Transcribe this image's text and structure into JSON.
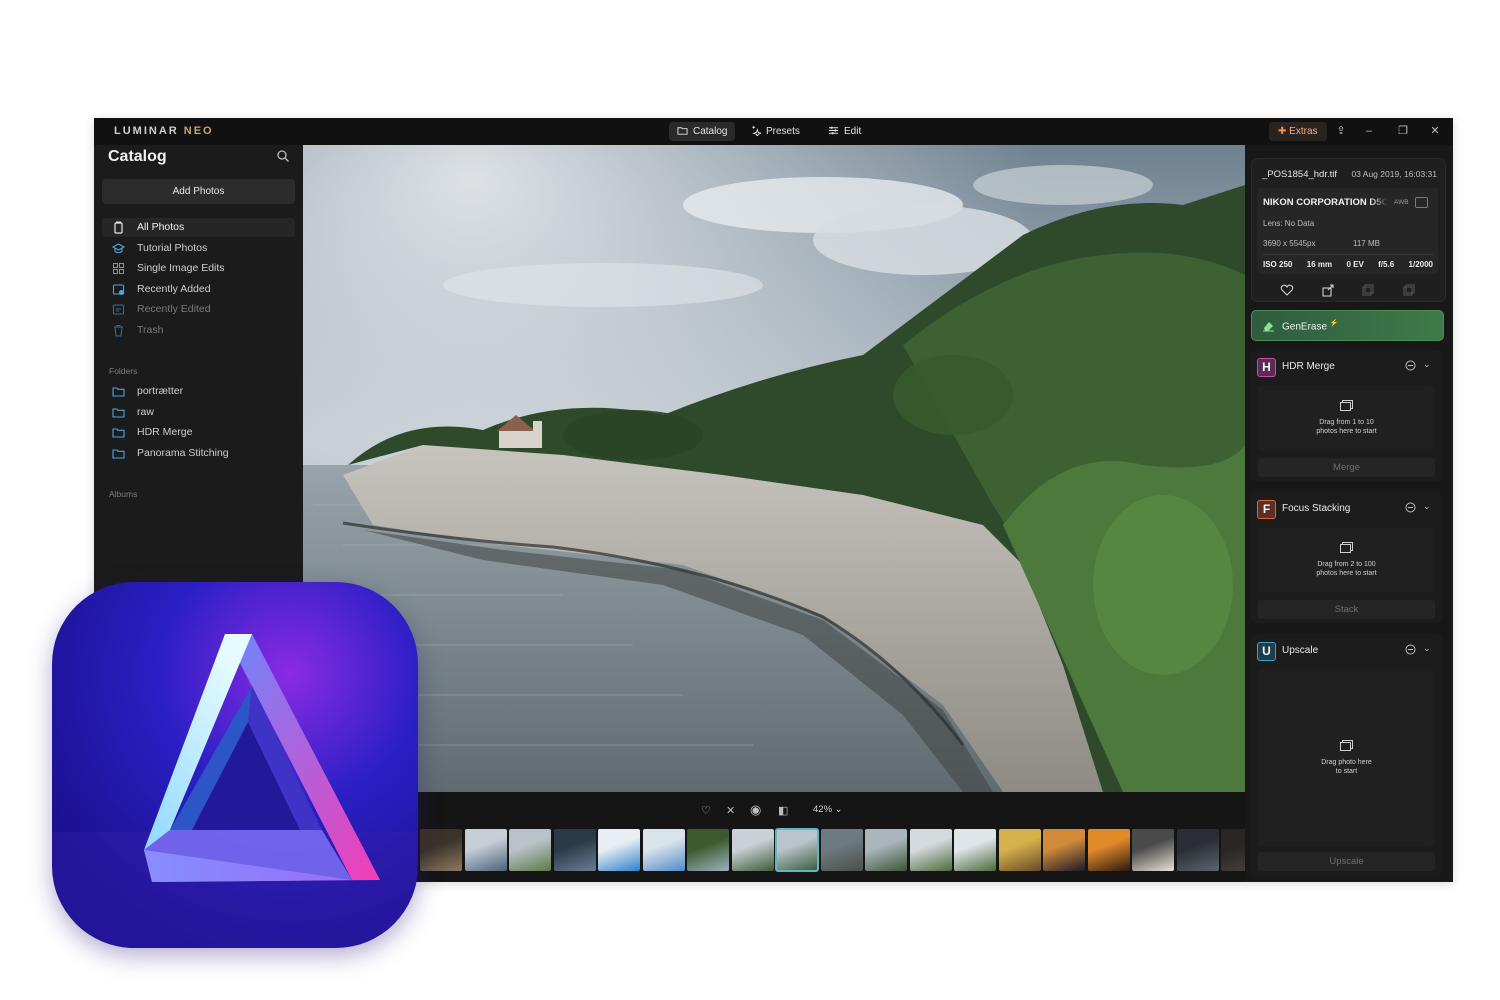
{
  "app": {
    "logo_main": "LUMINAR",
    "logo_accent": "NEO"
  },
  "nav": {
    "tabs": [
      {
        "label": "Catalog",
        "icon": "folder-icon"
      },
      {
        "label": "Presets",
        "icon": "sparkle-icon"
      },
      {
        "label": "Edit",
        "icon": "sliders-icon"
      }
    ],
    "active": "Catalog"
  },
  "topbar": {
    "extras_label": "Extras"
  },
  "sidebar": {
    "title": "Catalog",
    "add_photos": "Add Photos",
    "items": [
      {
        "label": "All Photos",
        "icon": "photos-icon"
      },
      {
        "label": "Tutorial Photos",
        "icon": "graduation-cap-icon"
      },
      {
        "label": "Single Image Edits",
        "icon": "grid-icon"
      },
      {
        "label": "Recently Added",
        "icon": "recently-added-icon"
      },
      {
        "label": "Recently Edited",
        "icon": "recently-edited-icon"
      },
      {
        "label": "Trash",
        "icon": "trash-icon"
      }
    ],
    "folders_heading": "Folders",
    "folders": [
      "portrætter",
      "raw",
      "HDR Merge",
      "Panorama Stitching"
    ],
    "albums_heading": "Albums"
  },
  "viewer": {
    "zoom": "42%"
  },
  "info": {
    "filename": "_POS1854_hdr.tif",
    "date": "03 Aug 2019, 16:03:31",
    "camera": "NIKON CORPORATION D5C",
    "awb": "AWB",
    "lens": "Lens: No Data",
    "dimensions": "3690 x 5545px",
    "file_size": "117 MB",
    "exif": [
      "ISO 250",
      "16 mm",
      "0 EV",
      "f/5.6",
      "1/2000"
    ]
  },
  "tools": {
    "generase": "GenErase",
    "generase_mark": "⚡",
    "hdr": {
      "badge": "H",
      "title": "HDR Merge",
      "drop_line1": "Drag from 1 to 10",
      "drop_line2": "photos here to start",
      "button": "Merge",
      "color": "#d04aa8"
    },
    "focus": {
      "badge": "F",
      "title": "Focus Stacking",
      "drop_line1": "Drag from 2 to 100",
      "drop_line2": "photos here to start",
      "button": "Stack",
      "color": "#e0683c"
    },
    "upscale": {
      "badge": "U",
      "title": "Upscale",
      "drop_line1": "Drag photo here",
      "drop_line2": "to start",
      "button": "Upscale",
      "color": "#3aa4c8"
    }
  }
}
